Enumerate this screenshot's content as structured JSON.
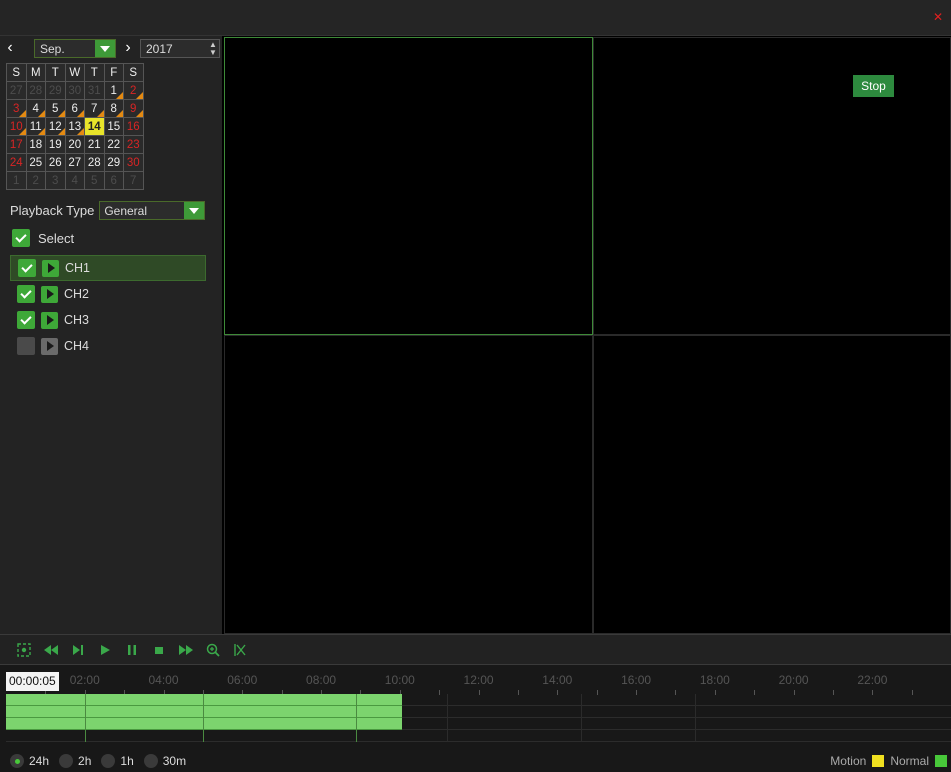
{
  "window": {
    "close_icon": "close-icon",
    "close_color": "#e02020"
  },
  "calendar": {
    "prev_icon": "chevron-left-icon",
    "next_icon": "chevron-right-icon",
    "month": "Sep.",
    "year": "2017",
    "weekdays": [
      "S",
      "M",
      "T",
      "W",
      "T",
      "F",
      "S"
    ],
    "weeks": [
      [
        {
          "d": "27",
          "t": "other"
        },
        {
          "d": "28",
          "t": "other"
        },
        {
          "d": "29",
          "t": "other"
        },
        {
          "d": "30",
          "t": "other"
        },
        {
          "d": "31",
          "t": "other"
        },
        {
          "d": "1",
          "t": "normal",
          "rec": true
        },
        {
          "d": "2",
          "t": "weekend",
          "rec": true
        }
      ],
      [
        {
          "d": "3",
          "t": "weekend",
          "rec": true
        },
        {
          "d": "4",
          "t": "normal",
          "rec": true
        },
        {
          "d": "5",
          "t": "normal",
          "rec": true
        },
        {
          "d": "6",
          "t": "normal",
          "rec": true
        },
        {
          "d": "7",
          "t": "normal",
          "rec": true
        },
        {
          "d": "8",
          "t": "normal",
          "rec": true
        },
        {
          "d": "9",
          "t": "weekend",
          "rec": true
        }
      ],
      [
        {
          "d": "10",
          "t": "weekend",
          "rec": true
        },
        {
          "d": "11",
          "t": "normal",
          "rec": true
        },
        {
          "d": "12",
          "t": "normal",
          "rec": true
        },
        {
          "d": "13",
          "t": "normal",
          "rec": true
        },
        {
          "d": "14",
          "t": "today"
        },
        {
          "d": "15",
          "t": "normal"
        },
        {
          "d": "16",
          "t": "weekend"
        }
      ],
      [
        {
          "d": "17",
          "t": "weekend"
        },
        {
          "d": "18",
          "t": "normal"
        },
        {
          "d": "19",
          "t": "normal"
        },
        {
          "d": "20",
          "t": "normal"
        },
        {
          "d": "21",
          "t": "normal"
        },
        {
          "d": "22",
          "t": "normal"
        },
        {
          "d": "23",
          "t": "weekend"
        }
      ],
      [
        {
          "d": "24",
          "t": "weekend"
        },
        {
          "d": "25",
          "t": "normal"
        },
        {
          "d": "26",
          "t": "normal"
        },
        {
          "d": "27",
          "t": "normal"
        },
        {
          "d": "28",
          "t": "normal"
        },
        {
          "d": "29",
          "t": "normal"
        },
        {
          "d": "30",
          "t": "weekend"
        }
      ],
      [
        {
          "d": "1",
          "t": "other"
        },
        {
          "d": "2",
          "t": "other"
        },
        {
          "d": "3",
          "t": "other"
        },
        {
          "d": "4",
          "t": "other"
        },
        {
          "d": "5",
          "t": "other"
        },
        {
          "d": "6",
          "t": "other"
        },
        {
          "d": "7",
          "t": "other"
        }
      ]
    ]
  },
  "playback": {
    "label": "Playback Type",
    "value": "General"
  },
  "select_all": {
    "label": "Select",
    "checked": true
  },
  "channels": [
    {
      "name": "CH1",
      "checked": true,
      "active": true
    },
    {
      "name": "CH2",
      "checked": true,
      "active": false
    },
    {
      "name": "CH3",
      "checked": true,
      "active": false
    },
    {
      "name": "CH4",
      "checked": false,
      "active": false
    }
  ],
  "video": {
    "stop_label": "Stop"
  },
  "controls": [
    "snapshot-icon",
    "rewind-icon",
    "step-forward-icon",
    "play-icon",
    "pause-icon",
    "stop-icon",
    "fast-forward-icon",
    "zoom-in-icon",
    "clip-icon"
  ],
  "timeline": {
    "current_time": "00:00:05",
    "labels": [
      "02:00",
      "04:00",
      "06:00",
      "08:00",
      "10:00",
      "12:00",
      "14:00",
      "16:00",
      "18:00",
      "20:00",
      "22:00"
    ],
    "recorded_until_hour": 10.05
  },
  "zoom": {
    "options": [
      {
        "label": "24h",
        "selected": true
      },
      {
        "label": "2h",
        "selected": false
      },
      {
        "label": "1h",
        "selected": false
      },
      {
        "label": "30m",
        "selected": false
      }
    ]
  },
  "legend": [
    {
      "label": "Motion",
      "color": "#f0e020"
    },
    {
      "label": "Normal",
      "color": "#48c83a"
    }
  ]
}
